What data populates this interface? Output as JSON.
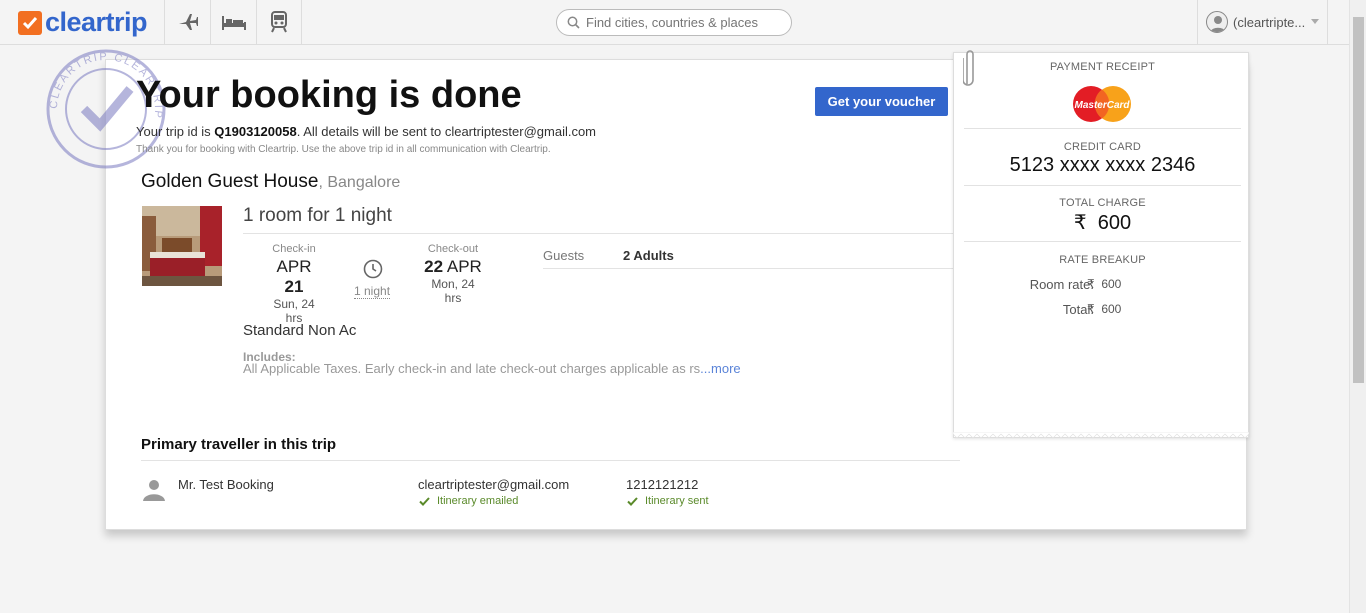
{
  "header": {
    "logo_text": "cleartrip",
    "nav_icons": [
      "flight-icon",
      "hotel-icon",
      "train-icon"
    ],
    "search_placeholder": "Find cities, countries & places",
    "account_label": "(cleartripte...",
    "brand_color": "#3366cc",
    "logo_mark_color": "#f26f21"
  },
  "stamp": {
    "text": "CLEARTRIP CLEARTRIP"
  },
  "booking": {
    "headline": "Your booking is done",
    "trip_prefix": "Your trip id is ",
    "trip_id": "Q1903120058",
    "trip_suffix": ". All details will be sent to cleartriptester@gmail.com",
    "thanks": "Thank you for booking with Cleartrip. Use the above trip id in all communication with Cleartrip.",
    "voucher_button": "Get your voucher"
  },
  "hotel": {
    "name": "Golden Guest House",
    "city": ", Bangalore",
    "room_summary": "1 room for 1 night",
    "checkin_label": "Check-in",
    "checkin_month": "APR ",
    "checkin_day": "21",
    "checkin_sub": "Sun, 24 hrs",
    "nights": "1 night",
    "checkout_label": "Check-out",
    "checkout_day": "22",
    "checkout_month": " APR",
    "checkout_sub": "Mon, 24 hrs",
    "guests_label": "Guests",
    "guests_value": "2 Adults",
    "room_type": "Standard Non Ac",
    "includes_label": "Includes:",
    "includes_text": "All Applicable Taxes. Early check-in and late check-out charges applicable as rs",
    "more_link": "...more"
  },
  "traveller": {
    "section_title": "Primary traveller in this trip",
    "name": "Mr. Test Booking",
    "email": "cleartriptester@gmail.com",
    "email_status": "Itinerary emailed",
    "phone": "1212121212",
    "phone_status": "Itinerary sent",
    "status_color": "#5a8a2a"
  },
  "receipt": {
    "title": "PAYMENT RECEIPT",
    "card_brand": "MasterCard",
    "card_label": "CREDIT CARD",
    "card_number": "5123 xxxx xxxx 2346",
    "total_label": "TOTAL CHARGE",
    "currency": "₹",
    "total_value": "600",
    "breakup_label": "RATE BREAKUP",
    "room_rate_label": "Room rate:",
    "room_rate_value": "600",
    "total_row_label": "Total:",
    "total_row_value": "600"
  }
}
